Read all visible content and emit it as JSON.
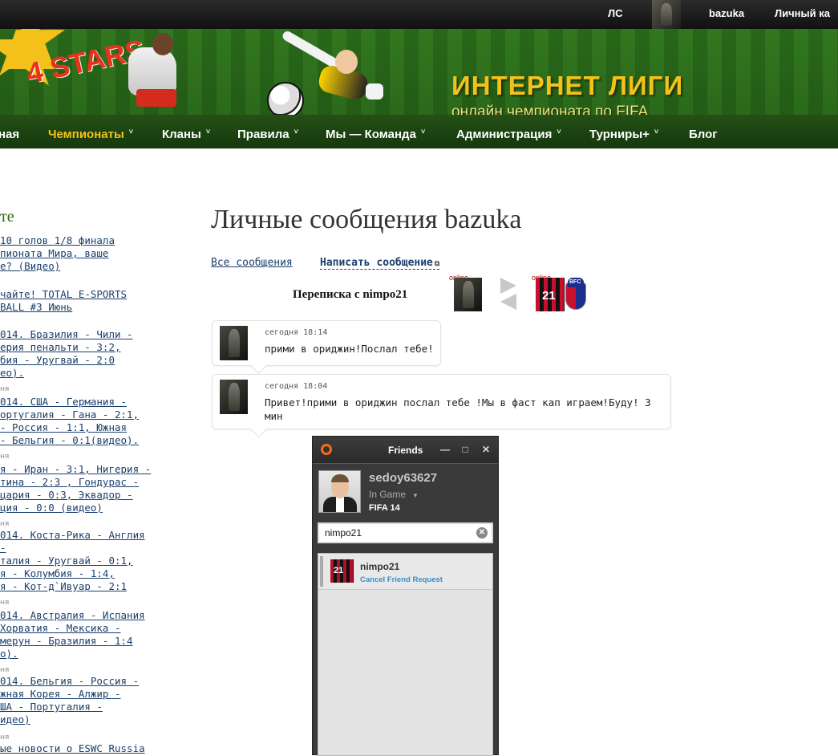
{
  "topbar": {
    "messages": "ЛС",
    "username": "bazuka",
    "cabinet": "Личный ка"
  },
  "banner": {
    "logo": "4 STARS",
    "headline": "ИНТЕРНЕТ ЛИГИ",
    "subheadline": "онлайн чемпионата по FIFA"
  },
  "nav": {
    "items": [
      {
        "label": "ная",
        "caret": ""
      },
      {
        "label": "Чемпионаты",
        "caret": "˅"
      },
      {
        "label": "Кланы",
        "caret": "˅"
      },
      {
        "label": "Правила",
        "caret": "˅"
      },
      {
        "label": "Мы — Команда",
        "caret": "˅"
      },
      {
        "label": "Администрация",
        "caret": "˅"
      },
      {
        "label": "Турниры+",
        "caret": "˅"
      },
      {
        "label": "Блог",
        "caret": ""
      }
    ]
  },
  "sidebar": {
    "title": "те",
    "news": [
      {
        "text": "10 голов 1/8 финала\nпионата Мира, ваше\nе? (Видео)",
        "date": ""
      },
      {
        "text": "чайте! TOTAL E-SPORTS\nBALL #3 Июнь",
        "date": ""
      },
      {
        "text": "014. Бразилия - Чили -\nерия пенальти - 3:2,\nбия - Уругвай - 2:0\nео).",
        "date": "ня"
      },
      {
        "text": "014. США - Германия -\nортугалия - Гана - 2:1,\n- Россия - 1:1, Южная\n- Бельгия - 0:1(видео).",
        "date": "ня"
      },
      {
        "text": "я - Иран - 3:1, Нигерия -\nтина - 2:3 , Гондурас -\nцария - 0:3, Эквадор -\nция - 0:0 (видео)",
        "date": "ня"
      },
      {
        "text": "014. Коста-Рика - Англия -\nталия - Уругвай - 0:1,\nя - Колумбия - 1:4,\nя - Кот-д`Ивуар - 2:1",
        "date": "ня"
      },
      {
        "text": "014. Австралия - Испания\nХорватия - Мексика -\nмерун - Бразилия - 1:4\nо).",
        "date": "ня"
      },
      {
        "text": "014. Бельгия - Россия -\nжная Корея - Алжир -\nША - Португалия -\nидео)",
        "date": "ня"
      },
      {
        "text": "ые новости о ESWC Russia",
        "date": ""
      }
    ]
  },
  "main": {
    "title": "Личные сообщения bazuka",
    "all_messages": "Все сообщения",
    "write_message": "Написать сообщение",
    "conversation": "Переписка с nimpo21",
    "online_left": "online",
    "online_right": "online",
    "jersey_number": "21",
    "club_badge": "BFC",
    "messages": [
      {
        "time": "сегодня 18:14",
        "text": "прими в ориджин!Послал тебе!"
      },
      {
        "time": "сегодня 18:04",
        "text": "Привет!прими в ориджин послал тебе !Мы в фаст кап играем!Буду! 3 мин"
      }
    ]
  },
  "friends_window": {
    "title": "Friends",
    "minimize": "—",
    "maximize": "□",
    "close": "✕",
    "username": "sedoy63627",
    "status": "In Game",
    "game": "FIFA 14",
    "search_value": "nimpo21",
    "clear": "✕",
    "result_name": "nimpo21",
    "result_action": "Cancel Friend Request",
    "result_jersey": "21"
  },
  "colors": {
    "nav_active": "#f4c11a",
    "banner_green": "#2f7a1d",
    "link": "#1a3f6b",
    "origin_orange": "#f56c1a",
    "friend_link": "#3b8fc4"
  }
}
